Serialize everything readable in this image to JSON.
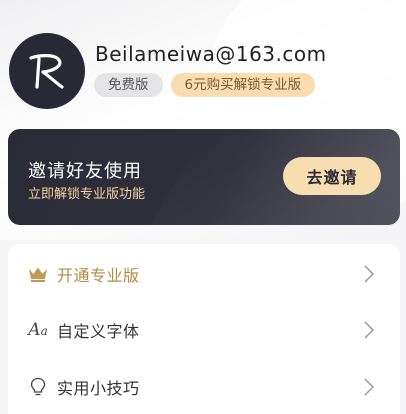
{
  "profile": {
    "email": "Beilameiwa@163.com",
    "plan_badge": "免费版",
    "upgrade_badge": "6元购买解锁专业版"
  },
  "invite": {
    "title": "邀请好友使用",
    "subtitle": "立即解锁专业版功能",
    "button": "去邀请"
  },
  "menu": {
    "items": [
      {
        "label": "开通专业版",
        "icon": "crown-icon"
      },
      {
        "label": "自定义字体",
        "icon": "font-icon"
      },
      {
        "label": "实用小技巧",
        "icon": "lightbulb-icon"
      }
    ]
  },
  "colors": {
    "gold": "#b58a45",
    "badge_gold_bg": "#f8ddb1",
    "dark_card": "#2a2b36"
  }
}
